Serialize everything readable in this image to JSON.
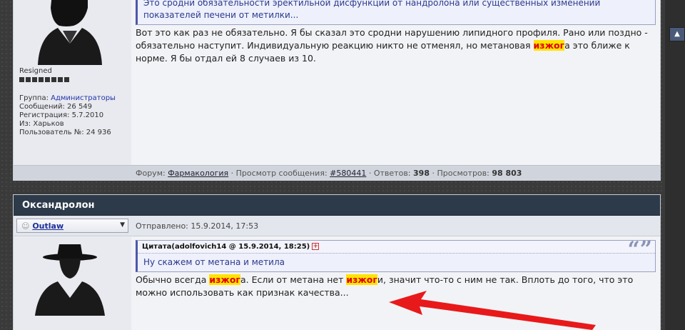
{
  "post1": {
    "quote_text": "Это сродни обязательности эректильной дисфункции от нандролона или существенных изменений показателей печени от метилки...",
    "message": {
      "part1": "Вот это как раз не обязательно. Я бы сказал это сродни нарушению липидного профиля. Рано или поздно - обязательно наступит. Индивидуальную реакцию никто не отменял, но метановая ",
      "highlight": "изжог",
      "part2": "а это ближе к норме. Я бы отдал ей 8 случаев из 10."
    },
    "user": {
      "status": "Resigned",
      "group_label": "Группа: ",
      "group_value": "Администраторы",
      "posts": "Сообщений: 26 549",
      "registered": "Регистрация: 5.7.2010",
      "from": "Из: Харьков",
      "user_no": "Пользователь №: 24 936"
    },
    "footer": {
      "forum_label": "Форум: ",
      "forum_name": "Фармакология",
      "view_label": " · Просмотр сообщения: ",
      "msg_id": "#580441",
      "replies_label": " · Ответов: ",
      "replies": "398",
      "views_label": " · Просмотров: ",
      "views": "98 803"
    }
  },
  "post2": {
    "title": "Оксандролон",
    "username": "Outlaw",
    "posted": "Отправлено: 15.9.2014, 17:53",
    "quote_header": "Цитата(adolfovich14 @ 15.9.2014, 18:25)",
    "quote_text": "Ну скажем от метана и метила",
    "message": {
      "part1": "Обычно всегда ",
      "hl1": "изжог",
      "part2": "а. Если от метана нет ",
      "hl2": "изжог",
      "part3": "и, значит что-то с ним не так. Вплоть до того, что это можно использовать как признак качества..."
    }
  },
  "colors": {
    "accent": "#2d3a4a",
    "highlight": "#ffe400",
    "arrow": "#e8191b"
  },
  "icons": {
    "user": "user-icon",
    "quote": "quote-icon",
    "dropdown": "chevron-down-icon"
  }
}
